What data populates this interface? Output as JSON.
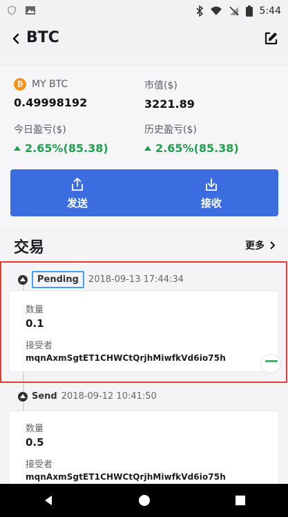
{
  "status": {
    "time": "5:44"
  },
  "appbar": {
    "title": "BTC"
  },
  "summary": {
    "my_label": "MY BTC",
    "my_value": "0.49998192",
    "market_label": "市值($)",
    "market_value": "3221.89",
    "today_label": "今日盈亏($)",
    "today_value": "2.65%(85.38)",
    "history_label": "历史盈亏($)",
    "history_value": "2.65%(85.38)"
  },
  "actions": {
    "send": "发送",
    "receive": "接收"
  },
  "transactions": {
    "title": "交易",
    "more": "更多",
    "items": [
      {
        "status": "Pending",
        "time": "2018-09-13 17:44:34",
        "amount_label": "数量",
        "amount": "0.1",
        "recipient_label": "接受者",
        "recipient": "mqnAxmSgtET1CHWCtQrjhMiwfkVd6io75h"
      },
      {
        "status": "Send",
        "time": "2018-09-12 10:41:50",
        "amount_label": "数量",
        "amount": "0.5",
        "recipient_label": "接受者",
        "recipient": "mqnAxmSgtET1CHWCtQrjhMiwfkVd6io75h"
      }
    ]
  },
  "colors": {
    "accent": "#3b6de0",
    "positive": "#1f9e4b",
    "highlight": "#e53935",
    "focus": "#3aa0ff"
  }
}
